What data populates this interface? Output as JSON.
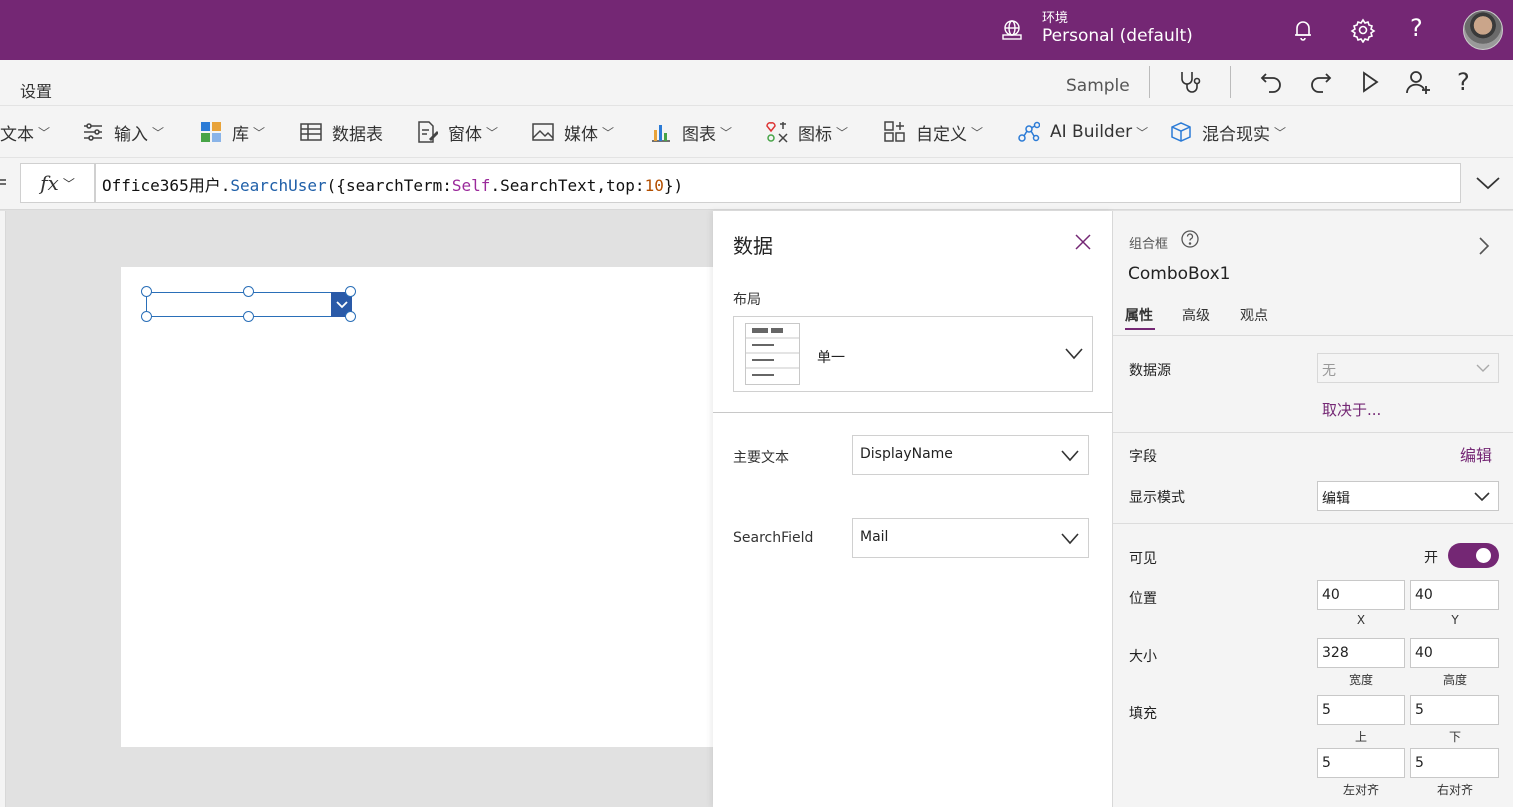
{
  "topbar": {
    "env_label": "环境",
    "env_value": "Personal (default)",
    "help": "?"
  },
  "cmdbar": {
    "settings": "设置",
    "sample": "Sample"
  },
  "ribbon": {
    "items": [
      {
        "label": "文本"
      },
      {
        "label": "输入"
      },
      {
        "label": "库"
      },
      {
        "label": "数据表"
      },
      {
        "label": "窗体"
      },
      {
        "label": "媒体"
      },
      {
        "label": "图表"
      },
      {
        "label": "图标"
      },
      {
        "label": "自定义"
      },
      {
        "label": "AI Builder"
      },
      {
        "label": "混合现实"
      }
    ]
  },
  "formula": {
    "fx": "fx",
    "tokens": {
      "t1": "Office365用户.",
      "t2": "SearchUser",
      "t3": "({searchTerm:",
      "t4": "Self",
      "t5": ".SearchText,top:",
      "t6": "10",
      "t7": "})"
    }
  },
  "data_panel": {
    "title": "数据",
    "layout_label": "布局",
    "layout_value": "单一",
    "primary_text_label": "主要文本",
    "primary_text_value": "DisplayName",
    "search_field_label": "SearchField",
    "search_field_value": "Mail"
  },
  "props": {
    "control_type": "组合框",
    "control_name": "ComboBox1",
    "tabs": [
      "属性",
      "高级",
      "观点"
    ],
    "data_source_label": "数据源",
    "data_source_value": "无",
    "depends_on": "取决于...",
    "fields_label": "字段",
    "fields_edit": "编辑",
    "display_mode_label": "显示模式",
    "display_mode_value": "编辑",
    "visible_label": "可见",
    "visible_state": "开",
    "position_label": "位置",
    "position_x": "40",
    "position_y": "40",
    "x_caption": "X",
    "y_caption": "Y",
    "size_label": "大小",
    "width": "328",
    "height": "40",
    "width_caption": "宽度",
    "height_caption": "高度",
    "padding_label": "填充",
    "pad_top": "5",
    "pad_bottom": "5",
    "pad_top_caption": "上",
    "pad_bottom_caption": "下",
    "pad_left": "5",
    "pad_right": "5",
    "pad_left_caption": "左对齐",
    "pad_right_caption": "右对齐"
  },
  "colors": {
    "brand": "#742774",
    "selection": "#2a6fb8"
  }
}
